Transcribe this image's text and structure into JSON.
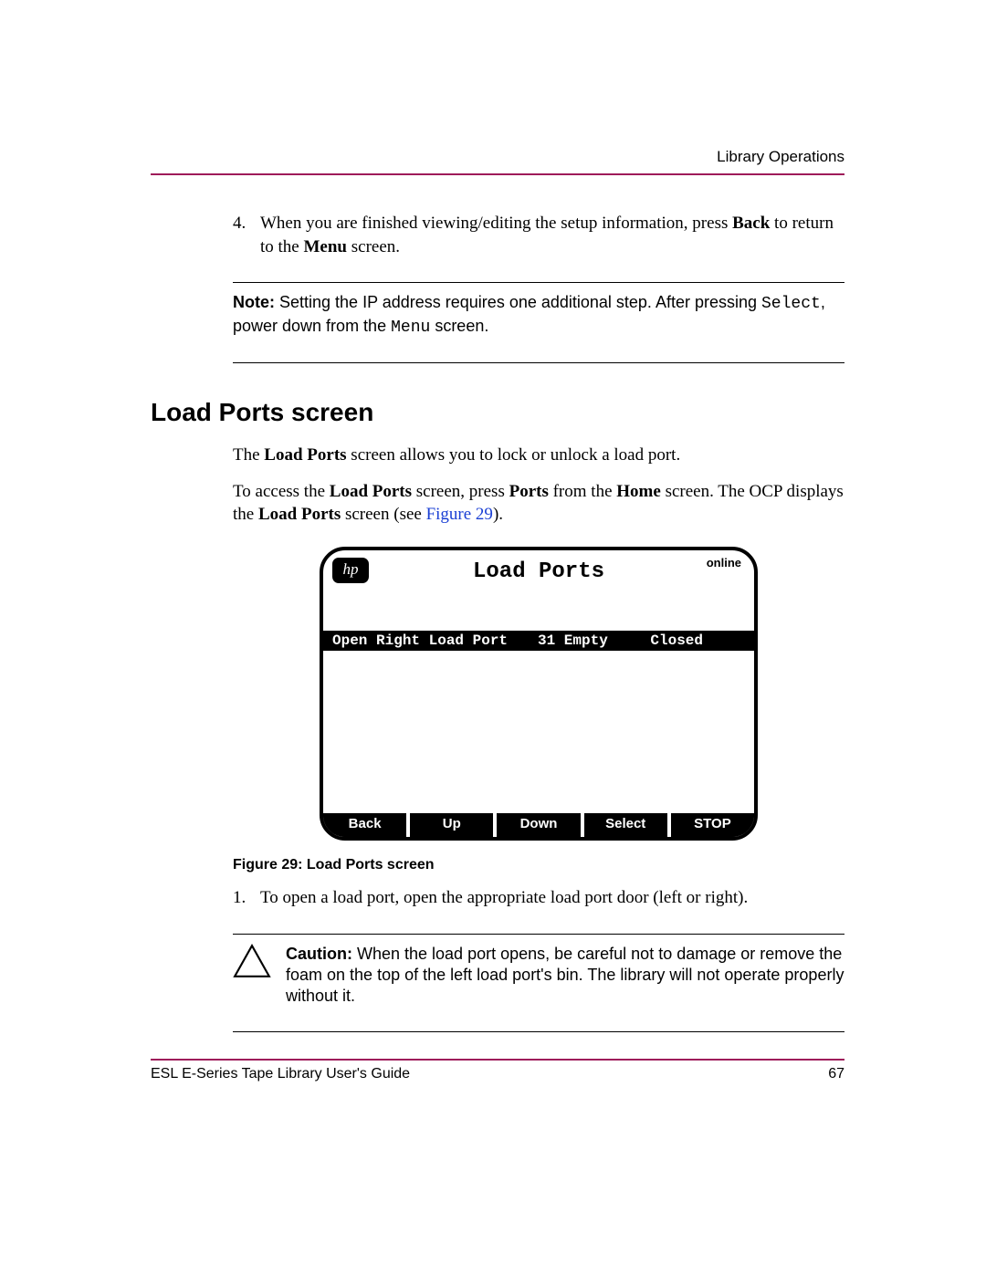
{
  "header": {
    "section_label": "Library Operations"
  },
  "step4": {
    "number": "4.",
    "text_pre": "When you are finished viewing/editing the setup information, press ",
    "bold1": "Back",
    "text_mid": " to return to the ",
    "bold2": "Menu",
    "text_post": " screen."
  },
  "note": {
    "label": "Note:",
    "t1": "  Setting the IP address requires one additional step. After pressing ",
    "mono1": "Select",
    "t2": ", power down from the ",
    "mono2": "Menu",
    "t3": " screen."
  },
  "section_title": "Load Ports screen",
  "para1": {
    "t1": "The ",
    "b1": "Load Ports",
    "t2": " screen allows you to lock or unlock a load port."
  },
  "para2": {
    "t1": "To access the ",
    "b1": "Load Ports",
    "t2": " screen, press ",
    "b2": "Ports",
    "t3": " from the ",
    "b3": "Home",
    "t4": " screen. The OCP displays the ",
    "b4": "Load Ports",
    "t5": " screen (see ",
    "link": "Figure 29",
    "t6": ")."
  },
  "device": {
    "logo": "hp",
    "title": "Load Ports",
    "status": "online",
    "row": {
      "name": "Open Right Load Port",
      "mid": "31 Empty",
      "state": "Closed"
    },
    "buttons": [
      "Back",
      "Up",
      "Down",
      "Select",
      "STOP"
    ]
  },
  "fig_caption": "Figure 29:  Load Ports screen",
  "step1": {
    "number": "1.",
    "text": "To open a load port, open the appropriate load port door (left or right)."
  },
  "caution": {
    "label": "Caution:",
    "text": "  When the load port opens, be careful not to damage or remove the foam on the top of the left load port's bin. The library will not operate properly without it."
  },
  "footer": {
    "title": "ESL E-Series Tape Library User's Guide",
    "page": "67"
  }
}
